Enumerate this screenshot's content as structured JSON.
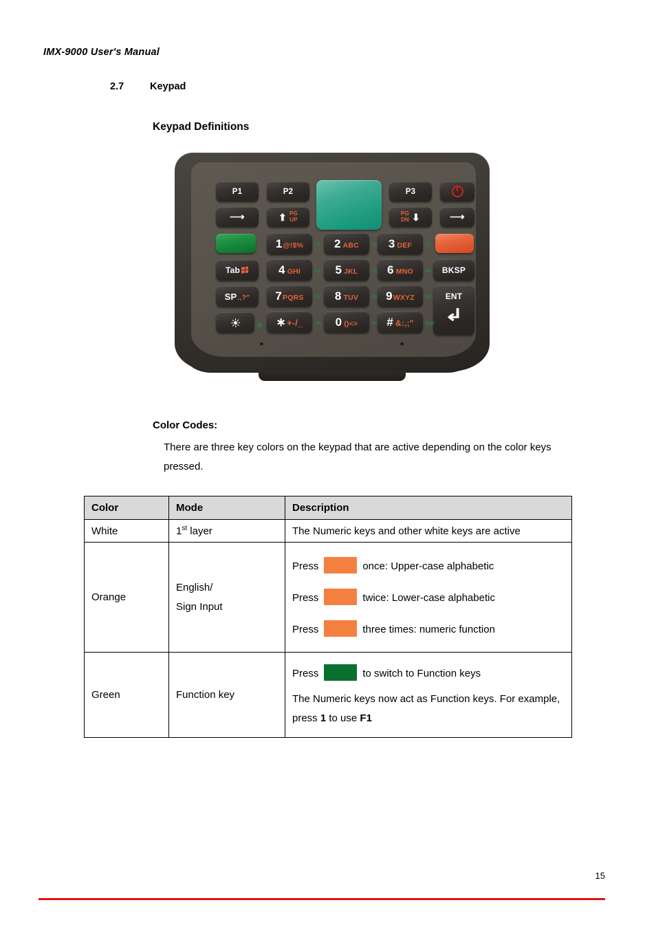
{
  "document": {
    "running_head": "IMX-9000 User's Manual",
    "page_number": "15",
    "rule_color": "#e41313"
  },
  "section": {
    "number": "2.7",
    "title": "Keypad",
    "subheading": "Keypad Definitions"
  },
  "keypad": {
    "caption": "Keypad Definitions",
    "colors": {
      "green_key": "#1f9243",
      "orange_key": "#e8653c",
      "scan_key": "#1d9b80",
      "alpha_text": "#e8603a",
      "function_text": "#1f8a46",
      "power_icon": "#d91e1e"
    },
    "rows": [
      {
        "keys": [
          {
            "name": "p1",
            "label": "P1"
          },
          {
            "name": "p2",
            "label": "P2"
          },
          {
            "name": "scan",
            "label": ""
          },
          {
            "name": "p3",
            "label": "P3"
          },
          {
            "name": "power",
            "label": "",
            "icon": "power-icon"
          }
        ]
      },
      {
        "keys": [
          {
            "name": "left-arrow",
            "label": "←"
          },
          {
            "name": "up-arrow-page-up",
            "label": "↑",
            "secondary": "PG\nUP"
          },
          {
            "name": "scan",
            "label": ""
          },
          {
            "name": "down-arrow-page-down",
            "label": "↓",
            "secondary": "PG\nDN"
          },
          {
            "name": "right-arrow",
            "label": "→"
          }
        ]
      },
      {
        "keys": [
          {
            "name": "green-function",
            "label": ""
          },
          {
            "name": "key-1",
            "label": "1",
            "alpha": "@!$%",
            "fn": "F1"
          },
          {
            "name": "key-2",
            "label": "2",
            "alpha": "ABC",
            "fn": "F2"
          },
          {
            "name": "key-3",
            "label": "3",
            "alpha": "DEF",
            "fn": "F3"
          },
          {
            "name": "orange-alpha",
            "label": ""
          }
        ]
      },
      {
        "keys": [
          {
            "name": "tab",
            "label": "Tab",
            "icon": "windows-icon"
          },
          {
            "name": "key-4",
            "label": "4",
            "alpha": "GHI",
            "fn": "F4"
          },
          {
            "name": "key-5",
            "label": "5",
            "alpha": "JKL",
            "fn": "F5"
          },
          {
            "name": "key-6",
            "label": "6",
            "alpha": "MNO",
            "fn": "F6"
          },
          {
            "name": "backspace",
            "label": "BKSP"
          }
        ]
      },
      {
        "keys": [
          {
            "name": "space",
            "label": "SP",
            "alpha": ".,?\""
          },
          {
            "name": "key-7",
            "label": "7",
            "alpha": "PQRS",
            "fn": "F7"
          },
          {
            "name": "key-8",
            "label": "8",
            "alpha": "TUV",
            "fn": "F8"
          },
          {
            "name": "key-9",
            "label": "9",
            "alpha": "WXYZ",
            "fn": "F9"
          },
          {
            "name": "enter",
            "label": "ENT"
          }
        ]
      },
      {
        "keys": [
          {
            "name": "brightness",
            "label": "",
            "icon": "sun-icon",
            "fn": "語"
          },
          {
            "name": "key-star",
            "label": "∗",
            "alpha": "+-/_",
            "fn": "Sft"
          },
          {
            "name": "key-0",
            "label": "0",
            "alpha": "()<>",
            "fn": "F10"
          },
          {
            "name": "key-hash",
            "label": "#",
            "alpha": "&:,;\"",
            "fn": "ESC"
          },
          {
            "name": "enter",
            "label": ""
          }
        ]
      }
    ]
  },
  "color_codes": {
    "title": "Color Codes:",
    "intro": "There are three key colors on the keypad that are active depending on the color keys pressed.",
    "table": {
      "headers": [
        "Color",
        "Mode",
        "Description"
      ],
      "rows": [
        {
          "color": "White",
          "mode_prefix": "1",
          "mode_sup": "st",
          "mode_suffix": " layer",
          "description": "The Numeric keys and other white keys are active"
        },
        {
          "color": "Orange",
          "mode_line1": "English/",
          "mode_line2": "Sign Input",
          "swatch_color": "#f4803f",
          "lines": [
            {
              "before": "Press",
              "after": "once: Upper-case alphabetic"
            },
            {
              "before": "Press",
              "after": "twice: Lower-case alphabetic"
            },
            {
              "before": "Press",
              "after": "three times: numeric function"
            }
          ]
        },
        {
          "color": "Green",
          "mode": "Function key",
          "swatch_color": "#0a7030",
          "line1_before": "Press",
          "line1_after": "to switch to Function keys",
          "line2_a": "The Numeric keys now act as Function keys. For example, press ",
          "line2_key": "1",
          "line2_b": " to use ",
          "line2_fn": "F1"
        }
      ]
    }
  }
}
